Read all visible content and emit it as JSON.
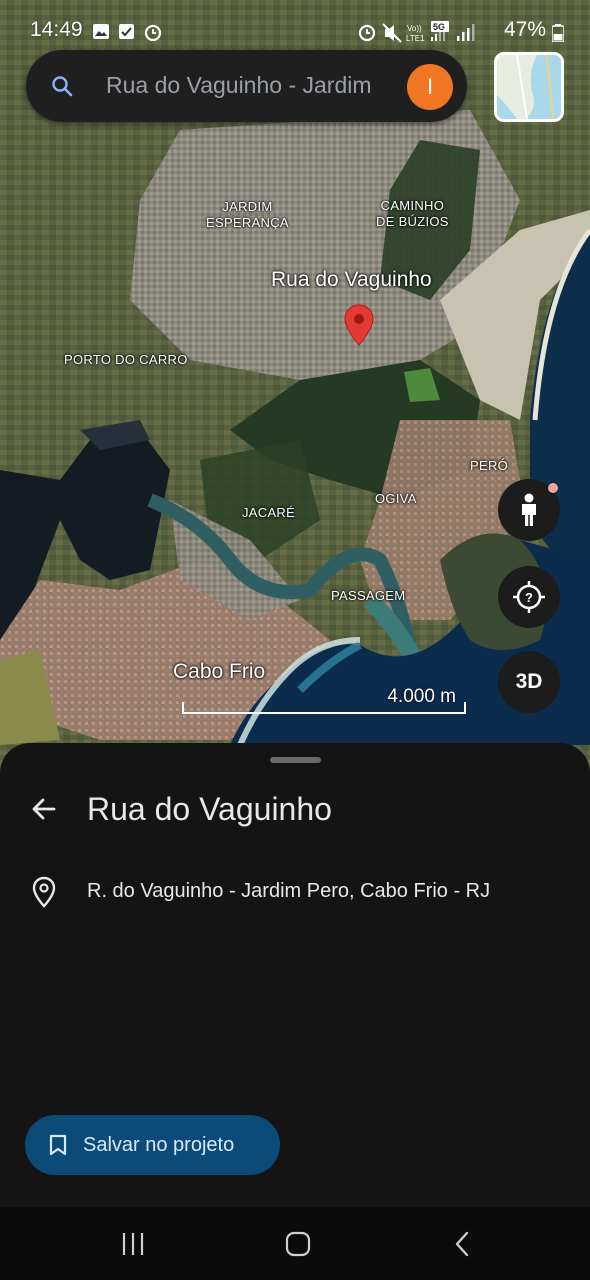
{
  "status_bar": {
    "time": "14:49",
    "battery": "47%",
    "left_icons": [
      "image-icon",
      "checkbox-icon",
      "alarm-icon"
    ],
    "right_icons": [
      "alarm-icon",
      "mute-icon",
      "volte-icon",
      "5g-icon",
      "signal-icon",
      "battery-icon"
    ]
  },
  "search": {
    "text": "Rua do Vaguinho - Jardim",
    "avatar_initial": "I",
    "avatar_color": "#f07623"
  },
  "map": {
    "labels": {
      "jardim_esperanca": "JARDIM\nESPERANÇA",
      "caminho_de_buzios": "CAMINHO\nDE BÚZIOS",
      "rua_do_vaguinho": "Rua do Vaguinho",
      "porto_do_carro": "PORTO DO CARRO",
      "pero": "PERÓ",
      "ogiva": "OGIVA",
      "jacare": "JACARÉ",
      "passagem": "PASSAGEM",
      "cabo_frio": "Cabo Frio"
    },
    "scale_text": "4.000 m",
    "btn_3d": "3D",
    "pin_color": "#e53935"
  },
  "sheet": {
    "title": "Rua do Vaguinho",
    "address": "R. do Vaguinho - Jardim Pero, Cabo Frio - RJ",
    "save_button": "Salvar no projeto",
    "save_button_color": "#0c4a77"
  },
  "navbar": {
    "icons": [
      "recent-apps-icon",
      "home-icon",
      "back-nav-icon"
    ]
  }
}
